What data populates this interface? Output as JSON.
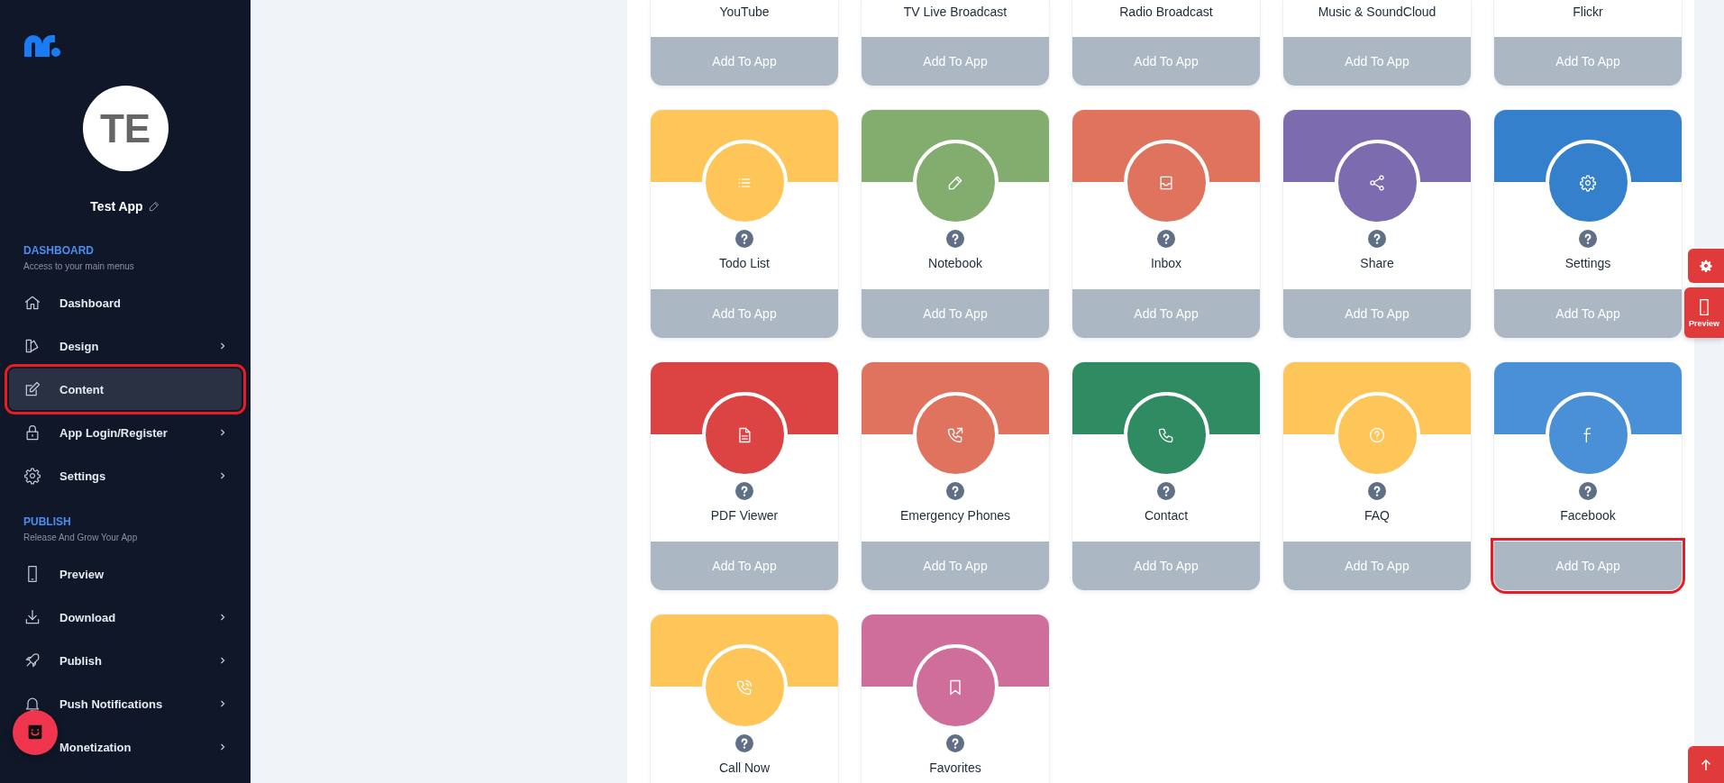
{
  "sidebar": {
    "app_name": "Test App",
    "avatar_initials": "TE",
    "sections": [
      {
        "title": "DASHBOARD",
        "subtitle": "Access to your main menus",
        "items": [
          {
            "label": "Dashboard",
            "expandable": false,
            "selected": false,
            "highlighted": false
          },
          {
            "label": "Design",
            "expandable": true,
            "selected": false,
            "highlighted": false
          },
          {
            "label": "Content",
            "expandable": false,
            "selected": true,
            "highlighted": true
          },
          {
            "label": "App Login/Register",
            "expandable": true,
            "selected": false,
            "highlighted": false
          },
          {
            "label": "Settings",
            "expandable": true,
            "selected": false,
            "highlighted": false
          }
        ]
      },
      {
        "title": "PUBLISH",
        "subtitle": "Release And Grow Your App",
        "items": [
          {
            "label": "Preview",
            "expandable": false,
            "selected": false,
            "highlighted": false
          },
          {
            "label": "Download",
            "expandable": true,
            "selected": false,
            "highlighted": false
          },
          {
            "label": "Publish",
            "expandable": true,
            "selected": false,
            "highlighted": false
          },
          {
            "label": "Push Notifications",
            "expandable": true,
            "selected": false,
            "highlighted": false
          },
          {
            "label": "Monetization",
            "expandable": true,
            "selected": false,
            "highlighted": false
          }
        ]
      }
    ]
  },
  "cards": [
    {
      "name": "YouTube",
      "button": "Add To App",
      "highlighted": false
    },
    {
      "name": "TV Live Broadcast",
      "button": "Add To App",
      "highlighted": false
    },
    {
      "name": "Radio Broadcast",
      "button": "Add To App",
      "highlighted": false
    },
    {
      "name": "Music & SoundCloud",
      "button": "Add To App",
      "highlighted": false
    },
    {
      "name": "Flickr",
      "button": "Add To App",
      "highlighted": false
    },
    {
      "name": "Todo List",
      "color": "#fec558",
      "button": "Add To App",
      "highlighted": false
    },
    {
      "name": "Notebook",
      "color": "#82ad6e",
      "button": "Add To App",
      "highlighted": false
    },
    {
      "name": "Inbox",
      "color": "#e0735e",
      "button": "Add To App",
      "highlighted": false
    },
    {
      "name": "Share",
      "color": "#7d6baf",
      "button": "Add To App",
      "highlighted": false
    },
    {
      "name": "Settings",
      "color": "#3580cc",
      "button": "Add To App",
      "highlighted": false
    },
    {
      "name": "PDF Viewer",
      "color": "#dc4343",
      "button": "Add To App",
      "highlighted": false
    },
    {
      "name": "Emergency Phones",
      "color": "#e0735e",
      "button": "Add To App",
      "highlighted": false
    },
    {
      "name": "Contact",
      "color": "#2e8b62",
      "button": "Add To App",
      "highlighted": false
    },
    {
      "name": "FAQ",
      "color": "#fec558",
      "button": "Add To App",
      "highlighted": false
    },
    {
      "name": "Facebook",
      "color": "#4a90d6",
      "button": "Add To App",
      "highlighted": true
    },
    {
      "name": "Call Now",
      "color": "#fec558"
    },
    {
      "name": "Favorites",
      "color": "#cf6e9a"
    }
  ],
  "floating": {
    "preview_label": "Preview"
  }
}
